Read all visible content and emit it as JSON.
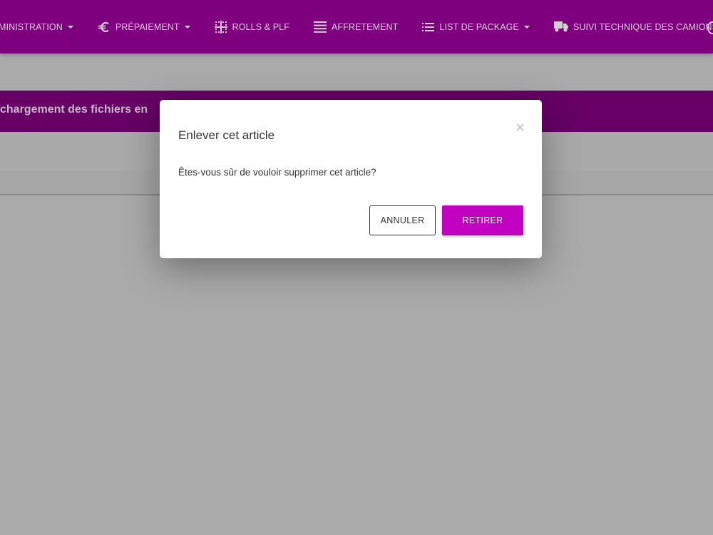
{
  "navbar": {
    "items": [
      {
        "label": "MINISTRATION",
        "icon": "",
        "has_caret": true
      },
      {
        "label": "PRÉPAIEMENT",
        "icon": "euro-icon",
        "has_caret": true
      },
      {
        "label": "ROLLS & PLF",
        "icon": "grid-icon",
        "has_caret": false
      },
      {
        "label": "AFFRETEMENT",
        "icon": "align-justify-icon",
        "has_caret": false
      },
      {
        "label": "LIST DE PACKAGE",
        "icon": "list-icon",
        "has_caret": true
      },
      {
        "label": "SUIVI TECHNIQUE DES CAMIONS",
        "icon": "truck-icon",
        "has_caret": false
      }
    ]
  },
  "banner": {
    "text": "chargement des fichiers en"
  },
  "modal": {
    "title": "Enlever cet article",
    "close_symbol": "×",
    "message": "Êtes-vous sûr de vouloir supprimer cet article?",
    "cancel_label": "ANNULER",
    "confirm_label": "RETIRER"
  },
  "colors": {
    "navbar": "#9a009a",
    "banner": "#7d007d",
    "confirm_button": "#c200c2",
    "background": "#d0d0d0"
  }
}
